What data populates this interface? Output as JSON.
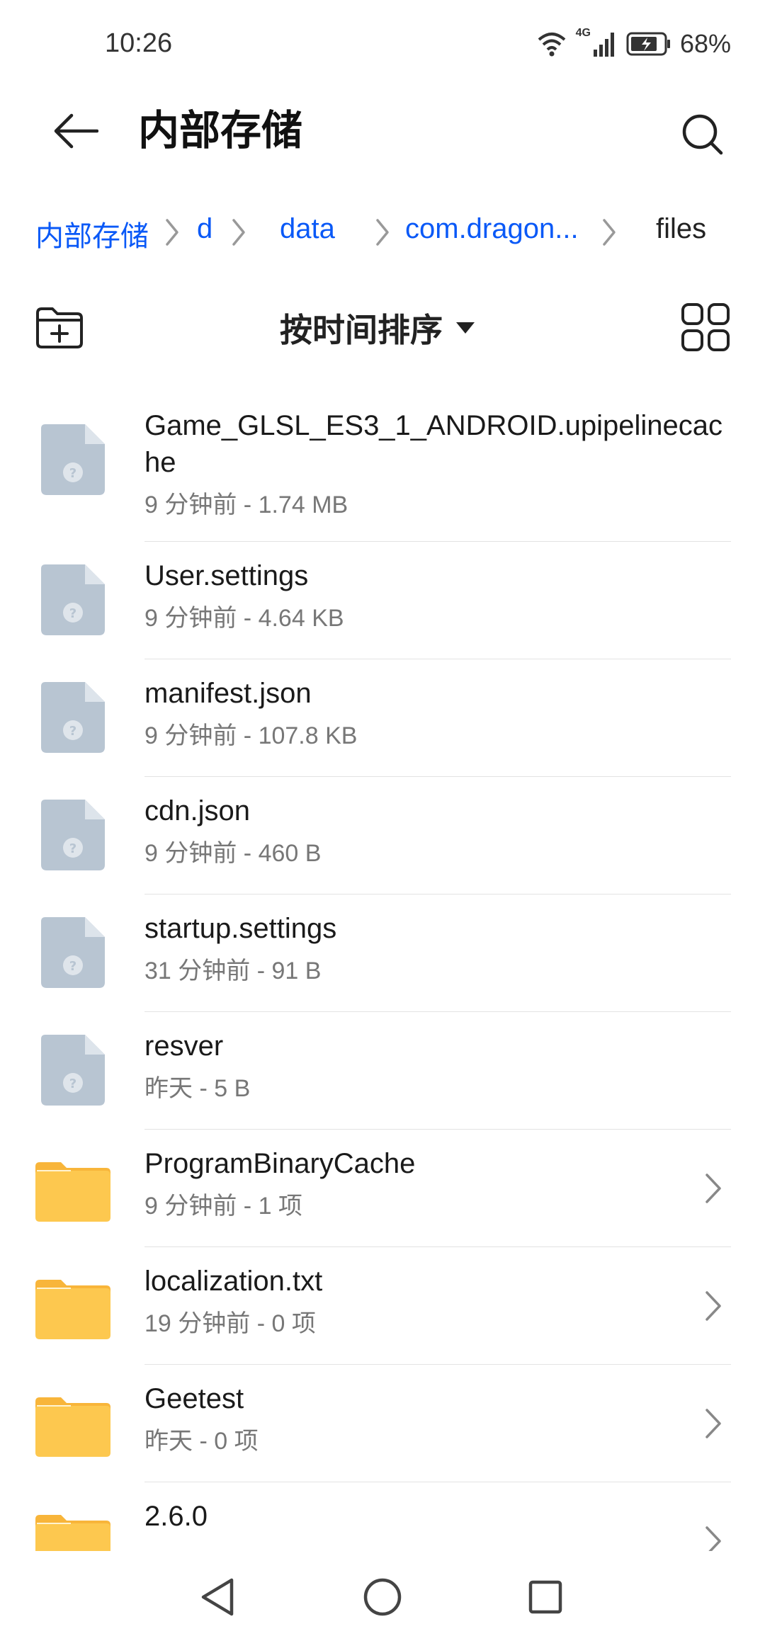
{
  "status_bar": {
    "time": "10:26",
    "network": "4G",
    "battery": "68%"
  },
  "app_bar": {
    "title": "内部存储",
    "back_icon": "arrow-left-icon",
    "search_icon": "search-icon"
  },
  "breadcrumb": [
    {
      "label": "内部存储"
    },
    {
      "label": "d"
    },
    {
      "label": "data"
    },
    {
      "label": "com.dragon..."
    },
    {
      "label": "files"
    }
  ],
  "toolbar": {
    "new_folder_icon": "new-folder-icon",
    "sort_label": "按时间排序",
    "view_toggle_icon": "grid-view-icon"
  },
  "files": [
    {
      "name": "Game_GLSL_ES3_1_ANDROID.upipelinecache",
      "meta": "9 分钟前 - 1.74 MB",
      "type": "file"
    },
    {
      "name": "User.settings",
      "meta": "9 分钟前 - 4.64 KB",
      "type": "file"
    },
    {
      "name": "manifest.json",
      "meta": "9 分钟前 - 107.8 KB",
      "type": "file"
    },
    {
      "name": "cdn.json",
      "meta": "9 分钟前 - 460 B",
      "type": "file"
    },
    {
      "name": "startup.settings",
      "meta": "31 分钟前 - 91 B",
      "type": "file"
    },
    {
      "name": "resver",
      "meta": "昨天 - 5 B",
      "type": "file"
    },
    {
      "name": "ProgramBinaryCache",
      "meta": "9 分钟前 - 1 项",
      "type": "folder"
    },
    {
      "name": "localization.txt",
      "meta": "19 分钟前 - 0 项",
      "type": "folder"
    },
    {
      "name": "Geetest",
      "meta": "昨天 - 0 项",
      "type": "folder"
    },
    {
      "name": "2.6.0",
      "meta": "",
      "type": "folder"
    }
  ],
  "colors": {
    "accent": "#0a59f7",
    "file_icon": "#b8c5d2",
    "folder": "#fdc84f",
    "folder_tab": "#f8b53a"
  }
}
